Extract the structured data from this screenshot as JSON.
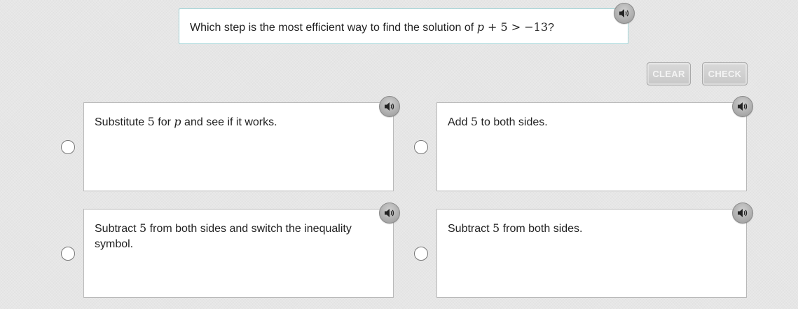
{
  "question": {
    "prefix": "Which step is the most efficient way to find the solution of ",
    "math_var": "p",
    "math_rest": " + 5 > −13",
    "suffix": "?"
  },
  "buttons": {
    "clear_label": "CLEAR",
    "check_label": "CHECK"
  },
  "options": [
    {
      "t1": "Substitute ",
      "m1": "5",
      "t2": " for ",
      "v1": "p",
      "t3": " and see if it works."
    },
    {
      "t1": "Add ",
      "m1": "5",
      "t2": " to both sides."
    },
    {
      "t1": "Subtract ",
      "m1": "5",
      "t2": " from both sides and switch the inequality symbol."
    },
    {
      "t1": "Subtract ",
      "m1": "5",
      "t2": " from both sides."
    }
  ],
  "icons": {
    "audio": "speaker-icon",
    "radio": "radio-circle"
  },
  "colors": {
    "question_border": "#9fd3d6",
    "button_fill": "#c8c8c8",
    "button_text": "#f4f4f4",
    "background": "#e6e6e6"
  }
}
